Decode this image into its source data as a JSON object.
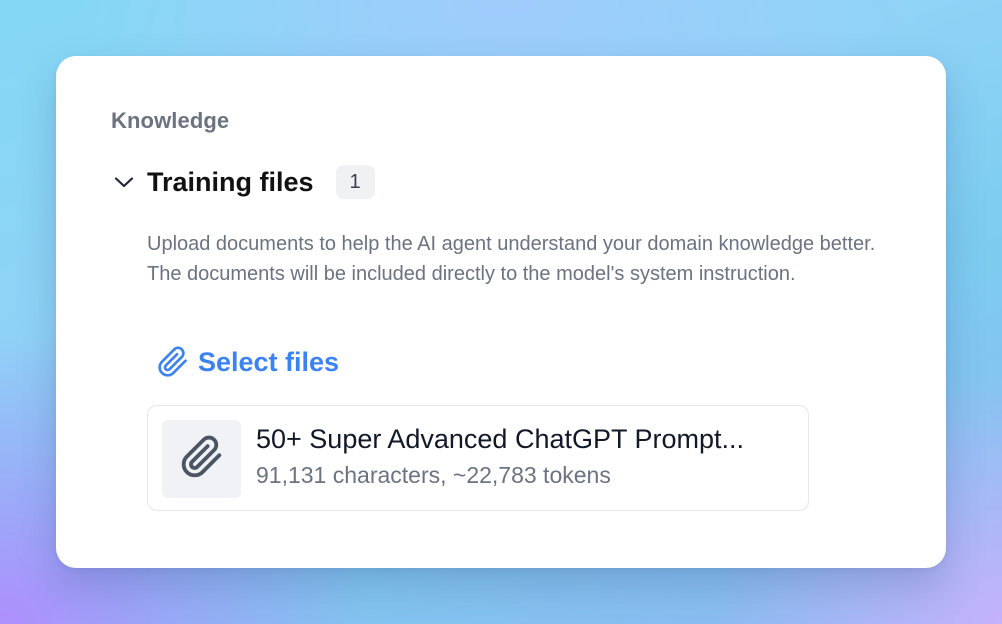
{
  "knowledge": {
    "section_label": "Knowledge",
    "training_files": {
      "title": "Training files",
      "count": "1",
      "expanded": true,
      "description": "Upload documents to help the AI agent understand your domain knowledge better. The documents will be included directly to the model's system instruction.",
      "select_files_label": "Select files",
      "files": [
        {
          "name": "50+ Super Advanced ChatGPT Prompt...",
          "meta": "91,131 characters, ~22,783 tokens",
          "icon": "paperclip-icon"
        }
      ]
    }
  },
  "icons": {
    "chevron": "chevron-down-icon",
    "select": "paperclip-icon"
  },
  "colors": {
    "accent": "#3b82f6",
    "muted_text": "#6b7280",
    "title_text": "#111111",
    "badge_bg": "#f0f1f3",
    "thumb_bg": "#f0f2f5",
    "thumb_icon": "#4b5563",
    "card_border": "#e5e7eb"
  }
}
